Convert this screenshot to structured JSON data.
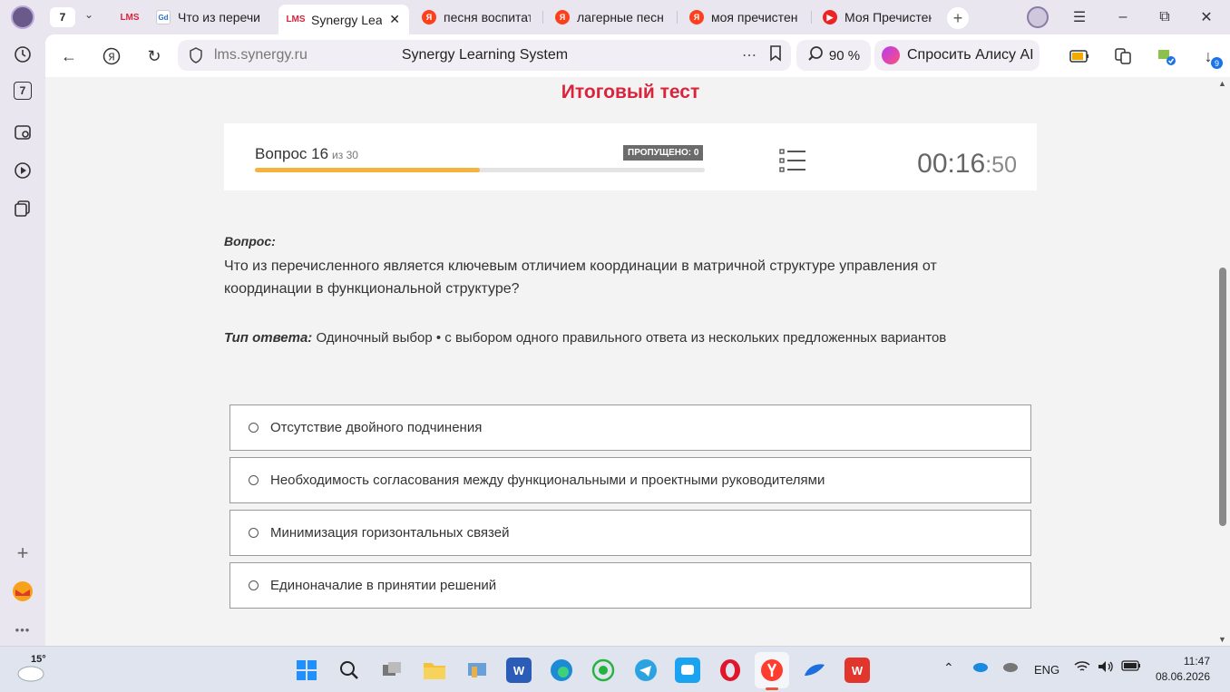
{
  "tabs": {
    "counter": "7",
    "items": [
      {
        "favicon": "LMS",
        "title": "",
        "active": false
      },
      {
        "favicon": "Gd",
        "title": "Что из перечис",
        "active": false
      },
      {
        "favicon": "LMS",
        "title": "Synergy Lear",
        "active": true
      },
      {
        "favicon": "Я",
        "title": "песня воспитат",
        "active": false
      },
      {
        "favicon": "Я",
        "title": "лагерные песн",
        "active": false
      },
      {
        "favicon": "Я",
        "title": "моя пречистен",
        "active": false
      },
      {
        "favicon": "▶",
        "title": "Моя Пречистен",
        "active": false
      }
    ]
  },
  "sidebar": {
    "tab_count": "7"
  },
  "address_bar": {
    "domain": "lms.synergy.ru",
    "page_title": "Synergy Learning System",
    "zoom": "90 %",
    "alice": "Спросить Алису AI",
    "downloads_badge": "9"
  },
  "test": {
    "title": "Итоговый тест",
    "question_label": "Вопрос 16",
    "question_of": "из 30",
    "skipped": "ПРОПУЩЕНО: 0",
    "progress": 0.5,
    "timer_main": "00:16",
    "timer_sec": ":50"
  },
  "question": {
    "label": "Вопрос:",
    "text": "Что из перечисленного является ключевым отличием координации в матричной структуре управления от координации в функциональной структуре?",
    "answer_type_label": "Тип ответа:",
    "answer_type": "Одиночный выбор • с выбором одного правильного ответа из нескольких предложенных вариантов"
  },
  "options": [
    "Отсутствие двойного подчинения",
    "Необходимость согласования между функциональными и проектными руководителями",
    "Минимизация горизонтальных связей",
    "Единоначалие в принятии решений"
  ],
  "taskbar": {
    "weather": "15°",
    "lang": "ENG",
    "time": "11:47",
    "date": "08.06.2026"
  },
  "colors": {
    "accent": "#d9243c",
    "progress": "#f3b33d"
  }
}
